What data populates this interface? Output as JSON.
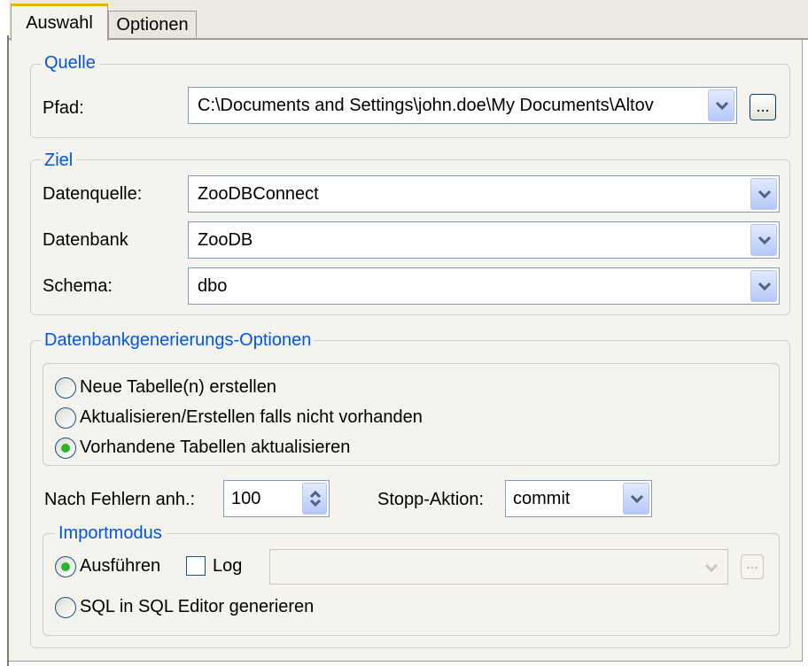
{
  "tabs": [
    {
      "label": "Auswahl",
      "active": true
    },
    {
      "label": "Optionen",
      "active": false
    }
  ],
  "quelle": {
    "legend": "Quelle",
    "pfad_label": "Pfad:",
    "pfad_value": "C:\\Documents and Settings\\john.doe\\My Documents\\Altov",
    "browse_label": "..."
  },
  "ziel": {
    "legend": "Ziel",
    "datenquelle_label": "Datenquelle:",
    "datenquelle_value": "ZooDBConnect",
    "datenbank_label": "Datenbank",
    "datenbank_value": "ZooDB",
    "schema_label": "Schema:",
    "schema_value": "dbo"
  },
  "optionen": {
    "legend": "Datenbankgenerierungs-Optionen",
    "radios": [
      {
        "label": "Neue Tabelle(n) erstellen",
        "checked": false
      },
      {
        "label": "Aktualisieren/Erstellen falls nicht vorhanden",
        "checked": false
      },
      {
        "label": "Vorhandene Tabellen aktualisieren",
        "checked": true
      }
    ],
    "fehler_label": "Nach Fehlern anh.:",
    "fehler_value": "100",
    "stopp_label": "Stopp-Aktion:",
    "stopp_value": "commit"
  },
  "import": {
    "legend": "Importmodus",
    "ausfuehren_label": "Ausführen",
    "ausfuehren_checked": true,
    "log_label": "Log",
    "log_checked": false,
    "log_browse_label": "...",
    "sql_label": "SQL in SQL Editor generieren",
    "sql_checked": false
  },
  "colors": {
    "accent_legend": "#0055e5",
    "tab_highlight": "#f0b000",
    "radio_selected": "#2db32d",
    "panel_bg": "#f4f3ee"
  },
  "icons": [
    "chevron-down-icon",
    "spinner-up-icon",
    "spinner-down-icon"
  ]
}
